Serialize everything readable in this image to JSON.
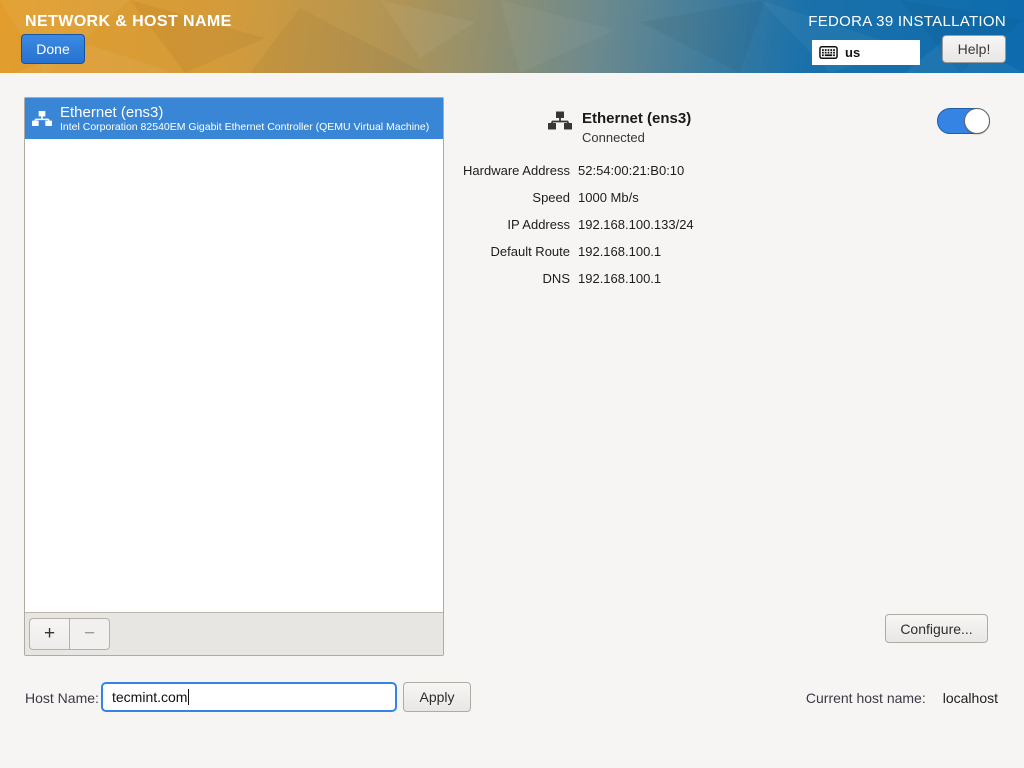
{
  "header": {
    "title": "NETWORK & HOST NAME",
    "done_button": "Done",
    "product_title": "FEDORA 39 INSTALLATION",
    "keyboard_layout": "us",
    "help_button": "Help!"
  },
  "device_list": {
    "selected_device": {
      "title": "Ethernet (ens3)",
      "subtitle": "Intel Corporation 82540EM Gigabit Ethernet Controller (QEMU Virtual Machine)"
    },
    "add_button": "+",
    "remove_button": "−"
  },
  "details": {
    "title": "Ethernet (ens3)",
    "status": "Connected",
    "toggle_state": "on",
    "rows": [
      {
        "label": "Hardware Address",
        "value": "52:54:00:21:B0:10"
      },
      {
        "label": "Speed",
        "value": "1000 Mb/s"
      },
      {
        "label": "IP Address",
        "value": "192.168.100.133/24"
      },
      {
        "label": "Default Route",
        "value": "192.168.100.1"
      },
      {
        "label": "DNS",
        "value": "192.168.100.1"
      }
    ],
    "configure_button": "Configure..."
  },
  "hostname": {
    "label": "Host Name:",
    "input_value": "tecmint.com",
    "apply_button": "Apply",
    "current_label": "Current host name:",
    "current_value": "localhost"
  },
  "colors": {
    "header_gradient_start": "#e29d2c",
    "header_gradient_end": "#0d6cae",
    "selection_blue": "#3986d6",
    "accent_blue": "#3584e4",
    "done_button_blue": "#2b7ddb"
  }
}
